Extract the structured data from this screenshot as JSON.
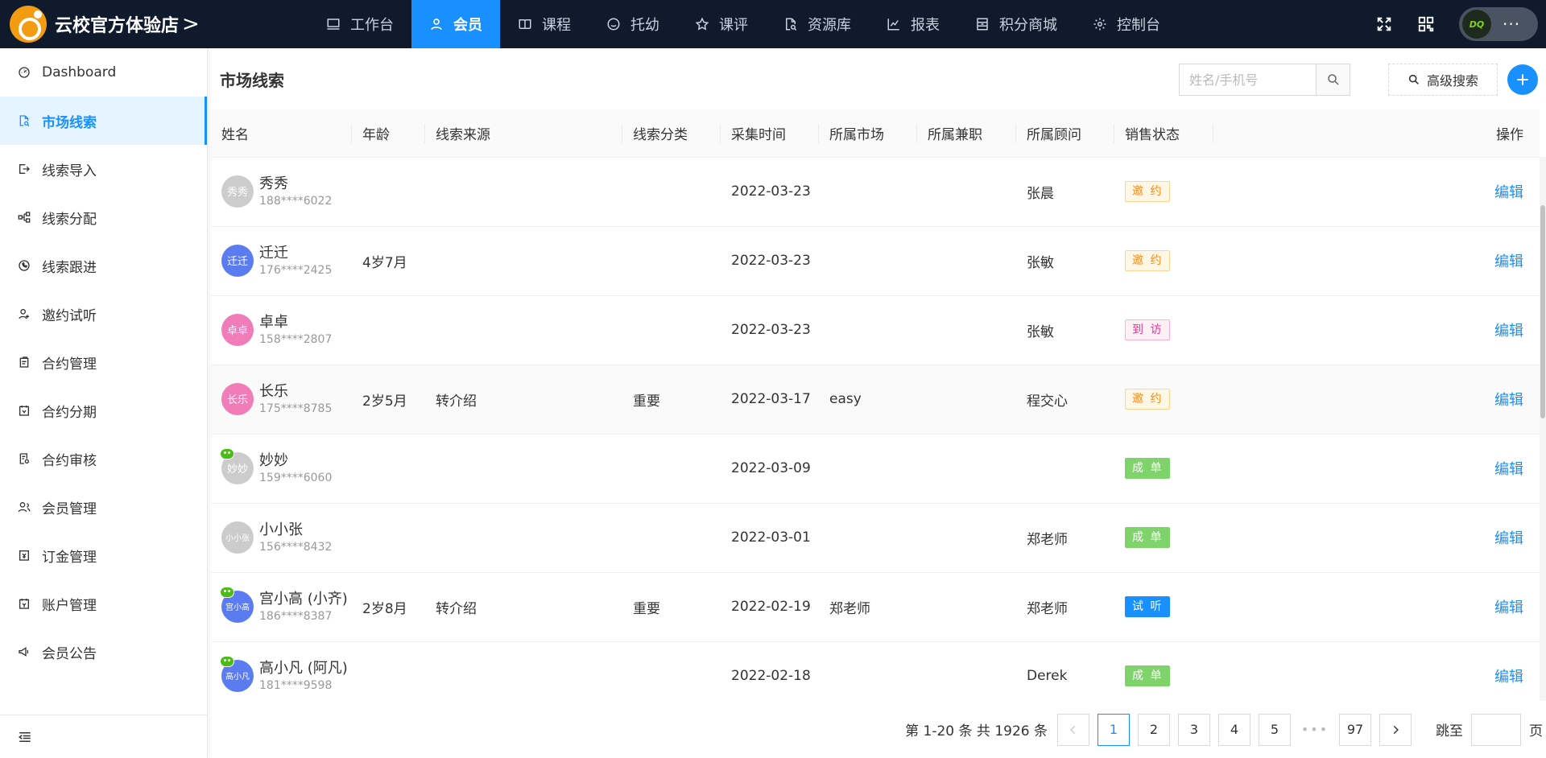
{
  "app": {
    "brand_name": "云校官方体验店",
    "brand_chevron": ">",
    "more_dots": "···",
    "avatar_text": "DQ"
  },
  "nav": [
    {
      "label": "工作台",
      "icon": "monitor-icon"
    },
    {
      "label": "会员",
      "icon": "user-icon",
      "active": true
    },
    {
      "label": "课程",
      "icon": "book-icon"
    },
    {
      "label": "托幼",
      "icon": "smile-icon"
    },
    {
      "label": "课评",
      "icon": "star-icon"
    },
    {
      "label": "资源库",
      "icon": "file-search-icon"
    },
    {
      "label": "报表",
      "icon": "chart-icon"
    },
    {
      "label": "积分商城",
      "icon": "shop-icon"
    },
    {
      "label": "控制台",
      "icon": "gear-icon"
    }
  ],
  "sidebar": {
    "items": [
      {
        "label": "Dashboard",
        "icon": "dashboard-icon"
      },
      {
        "label": "市场线索",
        "icon": "file-search-icon",
        "active": true
      },
      {
        "label": "线索导入",
        "icon": "import-icon"
      },
      {
        "label": "线索分配",
        "icon": "cluster-icon"
      },
      {
        "label": "线索跟进",
        "icon": "phone-icon"
      },
      {
        "label": "邀约试听",
        "icon": "user-add-icon"
      },
      {
        "label": "合约管理",
        "icon": "contract-icon"
      },
      {
        "label": "合约分期",
        "icon": "calendar-icon"
      },
      {
        "label": "合约审核",
        "icon": "audit-icon"
      },
      {
        "label": "会员管理",
        "icon": "team-icon"
      },
      {
        "label": "订金管理",
        "icon": "deposit-icon"
      },
      {
        "label": "账户管理",
        "icon": "account-icon"
      },
      {
        "label": "会员公告",
        "icon": "notification-icon"
      }
    ]
  },
  "page": {
    "title": "市场线索",
    "search_placeholder": "姓名/手机号",
    "advanced_search_label": "高级搜索"
  },
  "table": {
    "columns": [
      "姓名",
      "年龄",
      "线索来源",
      "线索分类",
      "采集时间",
      "所属市场",
      "所属兼职",
      "所属顾问",
      "销售状态",
      "操作"
    ],
    "rows": [
      {
        "avatar": "秀秀",
        "avatar_color": "#cccccc",
        "wechat": false,
        "name": "秀秀",
        "phone": "188****6022",
        "age": "",
        "source": "",
        "category": "",
        "time": "2022-03-23",
        "market": "",
        "parttime": "",
        "advisor": "张晨",
        "status": "邀 约",
        "status_type": "yaoyue",
        "action": "编辑"
      },
      {
        "avatar": "迁迁",
        "avatar_color": "#5b7cf0",
        "wechat": false,
        "name": "迁迁",
        "phone": "176****2425",
        "age": "4岁7月",
        "source": "",
        "category": "",
        "time": "2022-03-23",
        "market": "",
        "parttime": "",
        "advisor": "张敏",
        "status": "邀 约",
        "status_type": "yaoyue",
        "action": "编辑"
      },
      {
        "avatar": "卓卓",
        "avatar_color": "#f07cb8",
        "wechat": false,
        "name": "卓卓",
        "phone": "158****2807",
        "age": "",
        "source": "",
        "category": "",
        "time": "2022-03-23",
        "market": "",
        "parttime": "",
        "advisor": "张敏",
        "status": "到 访",
        "status_type": "daofang",
        "action": "编辑"
      },
      {
        "avatar": "长乐",
        "avatar_color": "#f07cb8",
        "wechat": false,
        "name": "长乐",
        "phone": "175****8785",
        "age": "2岁5月",
        "source": "转介绍",
        "category": "重要",
        "time": "2022-03-17",
        "market": "easy",
        "parttime": "",
        "advisor": "程交心",
        "status": "邀 约",
        "status_type": "yaoyue",
        "action": "编辑",
        "hover": true
      },
      {
        "avatar": "妙妙",
        "avatar_color": "#cccccc",
        "wechat": true,
        "name": "妙妙",
        "phone": "159****6060",
        "age": "",
        "source": "",
        "category": "",
        "time": "2022-03-09",
        "market": "",
        "parttime": "",
        "advisor": "",
        "status": "成 单",
        "status_type": "chengdan",
        "action": "编辑"
      },
      {
        "avatar": "小小张",
        "avatar_color": "#cccccc",
        "wechat": false,
        "name": "小小张",
        "phone": "156****8432",
        "age": "",
        "source": "",
        "category": "",
        "time": "2022-03-01",
        "market": "",
        "parttime": "",
        "advisor": "郑老师",
        "status": "成 单",
        "status_type": "chengdan",
        "action": "编辑"
      },
      {
        "avatar": "宫小高",
        "avatar_color": "#5b7cf0",
        "wechat": true,
        "name": "宫小高 (小齐)",
        "phone": "186****8387",
        "age": "2岁8月",
        "source": "转介绍",
        "category": "重要",
        "time": "2022-02-19",
        "market": "郑老师",
        "parttime": "",
        "advisor": "郑老师",
        "status": "试 听",
        "status_type": "shiting",
        "action": "编辑"
      },
      {
        "avatar": "高小凡",
        "avatar_color": "#5b7cf0",
        "wechat": true,
        "name": "高小凡 (阿凡)",
        "phone": "181****9598",
        "age": "",
        "source": "",
        "category": "",
        "time": "2022-02-18",
        "market": "",
        "parttime": "",
        "advisor": "Derek",
        "status": "成 单",
        "status_type": "chengdan",
        "action": "编辑"
      }
    ]
  },
  "pagination": {
    "total_text": "第 1-20 条 共 1926 条",
    "pages": [
      "1",
      "2",
      "3",
      "4",
      "5"
    ],
    "ellipsis": "•••",
    "last_page": "97",
    "current": "1",
    "jump_label": "跳至",
    "jump_suffix": "页"
  }
}
